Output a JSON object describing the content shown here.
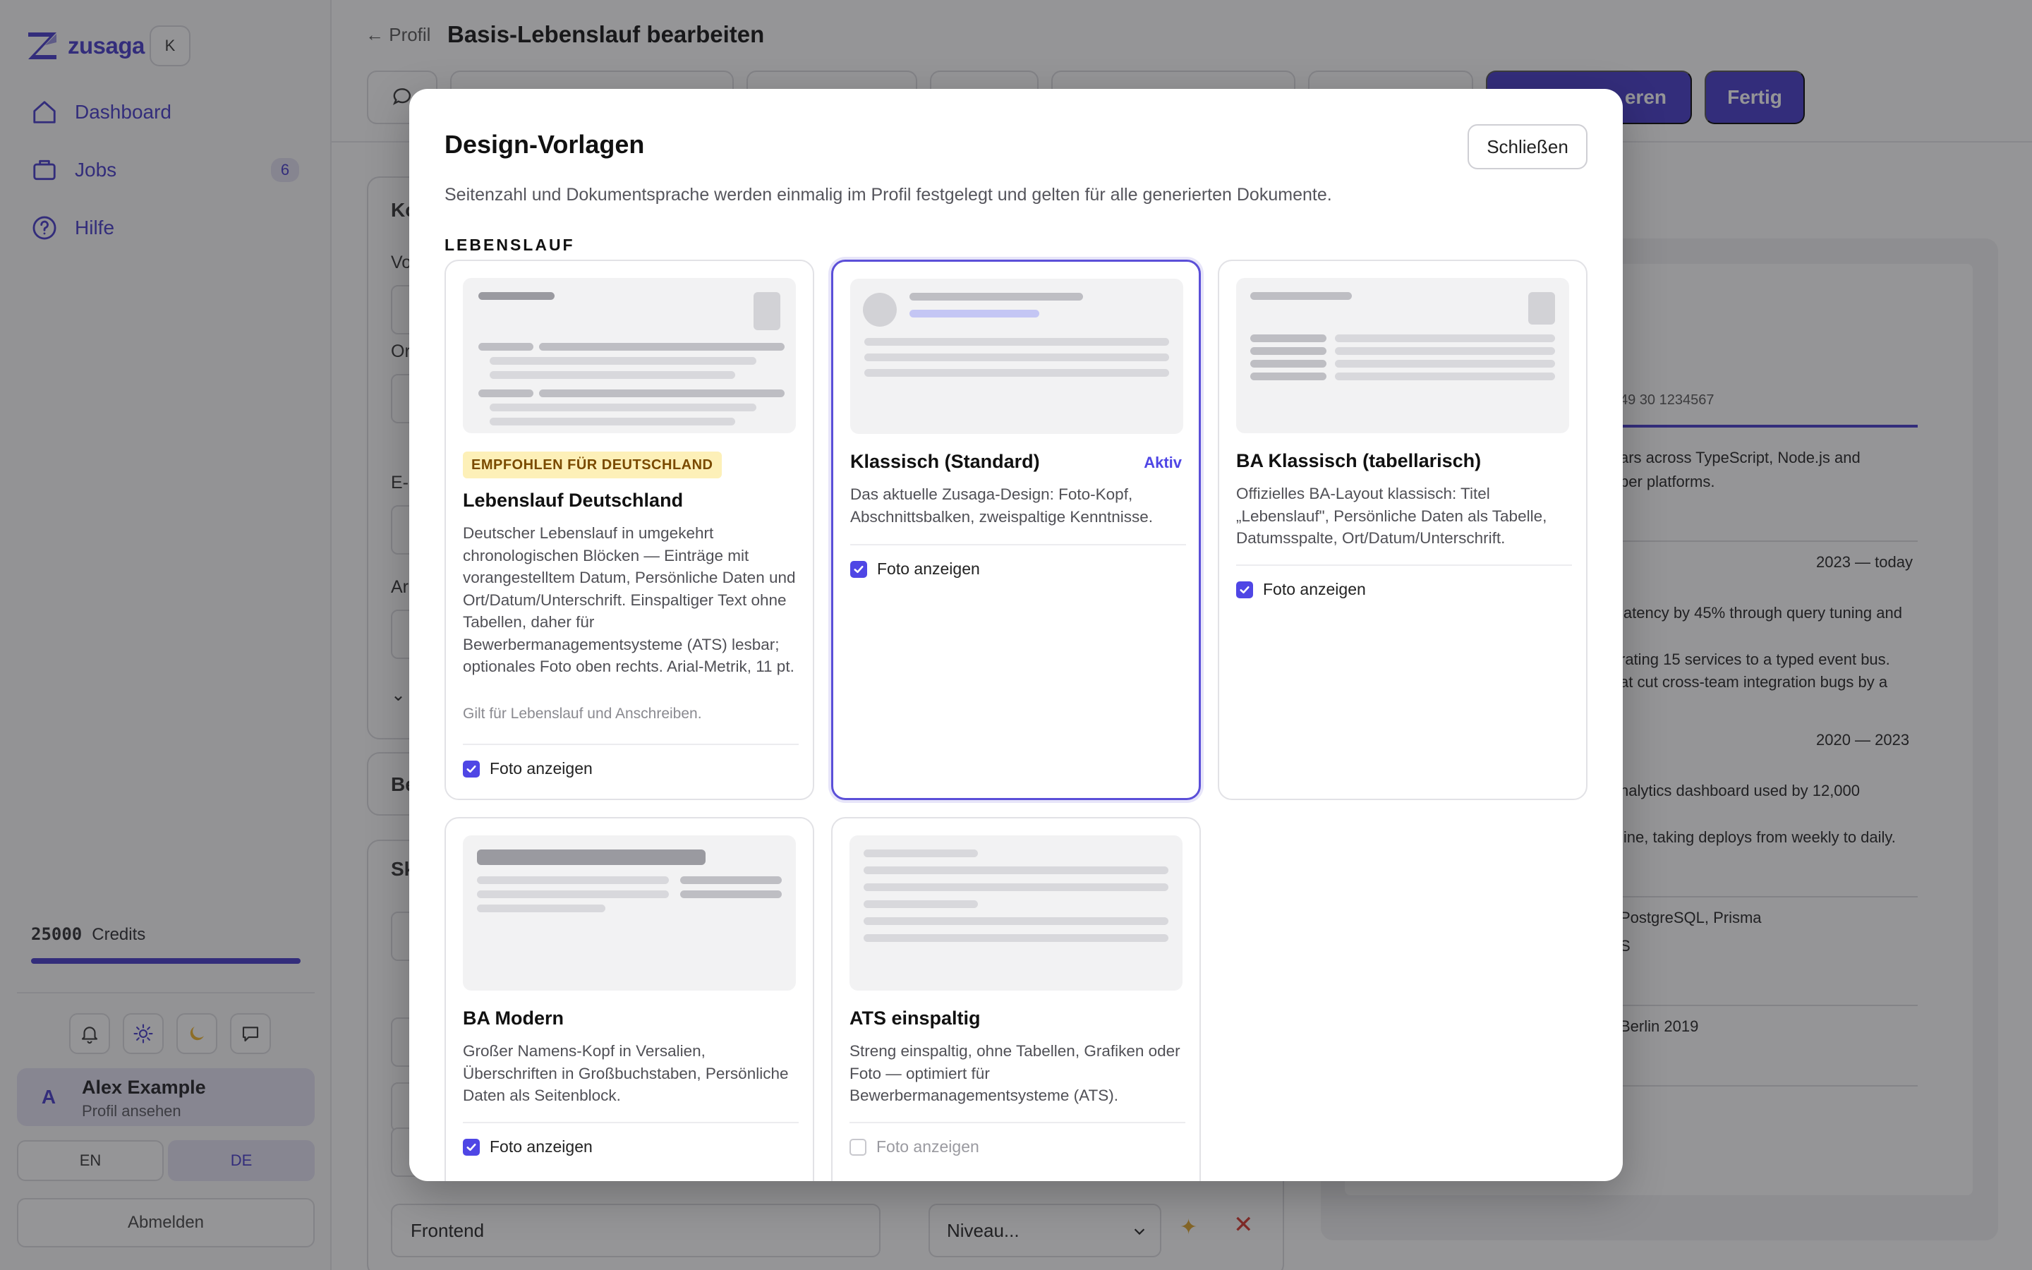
{
  "sidebar": {
    "brand": "zusaga",
    "workspace_initial": "K",
    "nav": [
      {
        "label": "Dashboard",
        "icon": "home-icon"
      },
      {
        "label": "Jobs",
        "icon": "briefcase-icon",
        "count": "6"
      },
      {
        "label": "Hilfe",
        "icon": "help-circle-icon"
      }
    ],
    "credits_value": "25000",
    "credits_label": "Credits",
    "credits_fraction": 1.0,
    "user": {
      "initial": "A",
      "name": "Alex Example",
      "sub": "Profil ansehen"
    },
    "languages": [
      "EN",
      "DE"
    ],
    "active_language": "DE",
    "logout": "Abmelden"
  },
  "header": {
    "back": "← Profil",
    "title": "Basis-Lebenslauf bearbeiten",
    "primary_partial": "eren",
    "done": "Fertig"
  },
  "form": {
    "card1_heading": "Ko",
    "label_vo": "Vo",
    "label_or": "Or",
    "label_e": "E-",
    "label_ar": "Ar",
    "toggle_partial": "⌄ I",
    "card2_heading": "Be",
    "card3_heading": "Sk",
    "skill_value": "Frontend",
    "niveau_placeholder": "Niveau..."
  },
  "preview": {
    "phone": "49 30 1234567",
    "summary_1": "ars across TypeScript, Node.js and",
    "summary_2": "per platforms.",
    "job1_dates": "2023 — today",
    "job1_b1": "latency by 45% through query tuning and",
    "job1_b2": "rating 15 services to a typed event bus.",
    "job1_b3": "at cut cross-team integration bugs by a",
    "job2_dates": "2020 — 2023",
    "job2_b1": "nalytics dashboard used by 12,000",
    "job2_b2": "line, taking deploys from weekly to daily.",
    "skills_1": "PostgreSQL, Prisma",
    "skills_2": "S",
    "edu_1": "Berlin 2019"
  },
  "modal": {
    "title": "Design-Vorlagen",
    "close": "Schließen",
    "subtitle": "Seitenzahl und Dokumentsprache werden einmalig im Profil festgelegt und gelten für alle generierten Dokumente.",
    "section": "LEBENSLAUF",
    "templates": [
      {
        "badge": "EMPFOHLEN FÜR DEUTSCHLAND",
        "title": "Lebenslauf Deutschland",
        "desc": "Deutscher Lebenslauf in umgekehrt chronologischen Blöcken — Einträge mit vorangestelltem Datum, Persönliche Daten und Ort/Datum/Unterschrift. Einspaltiger Text ohne Tabellen, daher für Bewerbermanagementsysteme (ATS) lesbar; optionales Foto oben rechts. Arial-Metrik, 11 pt.",
        "note": "Gilt für Lebenslauf und Anschreiben.",
        "photo_label": "Foto anzeigen",
        "photo": true
      },
      {
        "title": "Klassisch (Standard)",
        "active_label": "Aktiv",
        "desc": "Das aktuelle Zusaga-Design: Foto-Kopf, Abschnittsbalken, zweispaltige Kenntnisse.",
        "photo_label": "Foto anzeigen",
        "photo": true
      },
      {
        "title": "BA Klassisch (tabellarisch)",
        "desc": "Offizielles BA-Layout klassisch: Titel „Lebenslauf\", Persönliche Daten als Tabelle, Datumsspalte, Ort/Datum/Unterschrift.",
        "photo_label": "Foto anzeigen",
        "photo": true
      },
      {
        "title": "BA Modern",
        "desc": "Großer Namens-Kopf in Versalien, Überschriften in Großbuchstaben, Persönliche Daten als Seitenblock.",
        "photo_label": "Foto anzeigen",
        "photo": true
      },
      {
        "title": "ATS einspaltig",
        "desc": "Streng einspaltig, ohne Tabellen, Grafiken oder Foto — optimiert für Bewerbermanagementsysteme (ATS).",
        "photo_label": "Foto anzeigen",
        "photo": false,
        "photo_disabled": true
      }
    ]
  },
  "colors": {
    "accent": "#4338ca",
    "accent_light": "#e4e2f4",
    "badge_bg": "#fdf0b8",
    "delete_red": "#d9342b"
  }
}
